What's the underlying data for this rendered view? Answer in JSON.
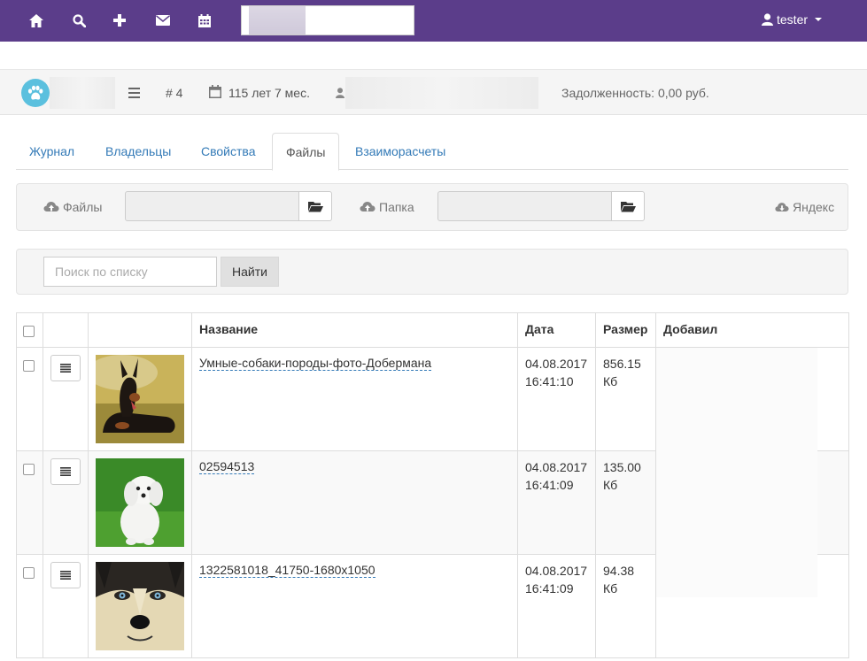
{
  "topbar": {
    "icons": [
      "home-icon",
      "search-icon",
      "plus-icon",
      "envelope-icon",
      "calendar-icon"
    ],
    "user_name": "tester"
  },
  "info": {
    "number": "# 4",
    "age": "115 лет 7 мес.",
    "debt": "Задолженность: 0,00 руб."
  },
  "tabs": [
    {
      "label": "Журнал"
    },
    {
      "label": "Владельцы"
    },
    {
      "label": "Свойства"
    },
    {
      "label": "Файлы"
    },
    {
      "label": "Взаиморасчеты"
    }
  ],
  "upload": {
    "files_label": "Файлы",
    "folder_label": "Папка",
    "yandex_label": "Яндекс"
  },
  "filter": {
    "placeholder": "Поиск по списку",
    "button": "Найти"
  },
  "table": {
    "headers": {
      "name": "Название",
      "date": "Дата",
      "size": "Размер",
      "added_by": "Добавил"
    },
    "rows": [
      {
        "name": "Умные-собаки-породы-фото-Добермана",
        "date": "04.08.2017",
        "time": "16:41:10",
        "size": "856.15",
        "unit": "Кб"
      },
      {
        "name": "02594513",
        "date": "04.08.2017",
        "time": "16:41:09",
        "size": "135.00",
        "unit": "Кб"
      },
      {
        "name": "1322581018_41750-1680x1050",
        "date": "04.08.2017",
        "time": "16:41:09",
        "size": "94.38",
        "unit": "Кб"
      }
    ]
  },
  "colors": {
    "topbar": "#5b3d8a",
    "link": "#337ab7",
    "paw_badge": "#5bc0de"
  }
}
